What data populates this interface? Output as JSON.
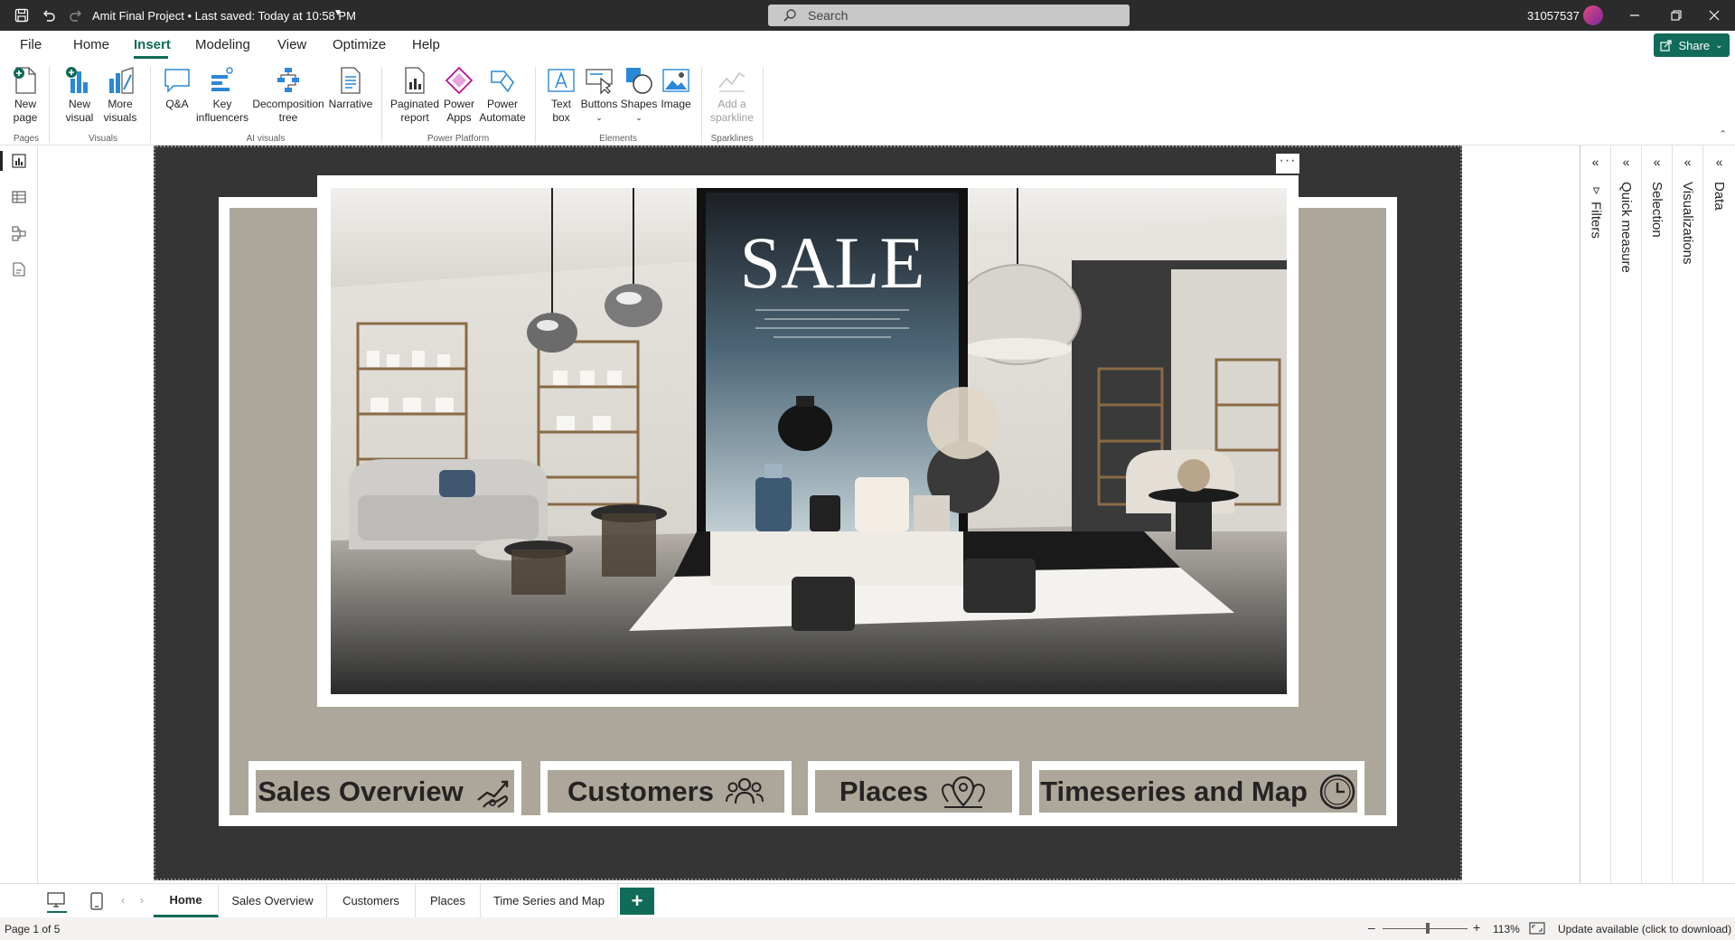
{
  "window": {
    "title": "Amit Final Project • Last saved: Today at 10:58 PM",
    "search_placeholder": "Search",
    "user_id": "31057537",
    "share_label": "Share"
  },
  "menu": {
    "tabs": [
      "File",
      "Home",
      "Insert",
      "Modeling",
      "View",
      "Optimize",
      "Help"
    ],
    "active": "Insert"
  },
  "ribbon": {
    "new_page": [
      "New",
      "page"
    ],
    "new_visual": [
      "New",
      "visual"
    ],
    "more_visuals": [
      "More",
      "visuals"
    ],
    "qa": "Q&A",
    "key_influencers": [
      "Key",
      "influencers"
    ],
    "decomposition_tree": [
      "Decomposition",
      "tree"
    ],
    "narrative": "Narrative",
    "paginated_report": [
      "Paginated",
      "report"
    ],
    "power_apps": [
      "Power",
      "Apps"
    ],
    "power_automate": [
      "Power",
      "Automate"
    ],
    "text_box": [
      "Text",
      "box"
    ],
    "buttons": "Buttons",
    "shapes": "Shapes",
    "image": "Image",
    "add_sparkline": [
      "Add a",
      "sparkline"
    ],
    "groups": {
      "pages": "Pages",
      "visuals": "Visuals",
      "ai_visuals": "AI visuals",
      "power_platform": "Power Platform",
      "elements": "Elements",
      "sparklines": "Sparklines"
    }
  },
  "report": {
    "hero_sign": "SALE",
    "nav_buttons": [
      "Sales Overview",
      "Customers",
      "Places",
      "Timeseries and Map"
    ]
  },
  "panes": [
    "Filters",
    "Quick measure",
    "Selection",
    "Visualizations",
    "Data"
  ],
  "page_tabs": {
    "tabs": [
      "Home",
      "Sales Overview",
      "Customers",
      "Places",
      "Time Series and Map"
    ],
    "active": "Home"
  },
  "status": {
    "page_info": "Page 1 of 5",
    "zoom": "113%",
    "update": "Update available (click to download)"
  },
  "colors": {
    "accent": "#106b58",
    "frame": "#353535",
    "beige": "#ada69a"
  }
}
